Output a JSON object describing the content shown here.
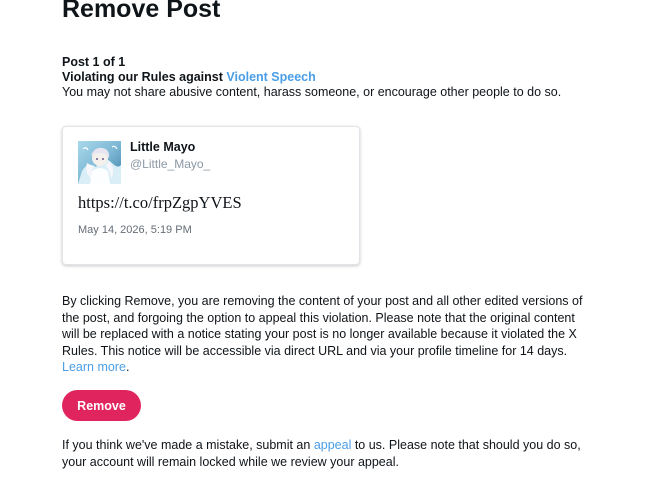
{
  "page": {
    "title": "Remove Post"
  },
  "violation": {
    "post_count": "Post 1 of 1",
    "rule_prefix": "Violating our Rules against ",
    "rule_link": "Violent Speech",
    "description": "You may not share abusive content, harass someone, or encourage other people to do so."
  },
  "post": {
    "author_name": "Little Mayo",
    "author_handle": "@Little_Mayo_",
    "text": "https://t.co/frpZgpYVES",
    "timestamp": "May 14, 2026, 5:19 PM"
  },
  "explanation": {
    "text": "By clicking Remove, you are removing the content of your post and all other edited versions of the post, and forgoing the option to appeal this violation. Please note that the original content will be replaced with a notice stating your post is no longer available because it violated the X Rules. This notice will be accessible via direct URL and via your profile timeline for 14 days.",
    "learn_more": "Learn more",
    "period": "."
  },
  "actions": {
    "remove_label": "Remove"
  },
  "appeal": {
    "prefix": "If you think we've made a mistake, submit an ",
    "link": "appeal",
    "suffix": " to us. Please note that should you do so, your account will remain locked while we review your appeal."
  },
  "colors": {
    "link": "#4a9ee6",
    "remove_button": "#e0245e",
    "text": "#0f1419",
    "muted": "#8b98a5"
  },
  "icons": {
    "avatar": "anime-character-avatar"
  }
}
